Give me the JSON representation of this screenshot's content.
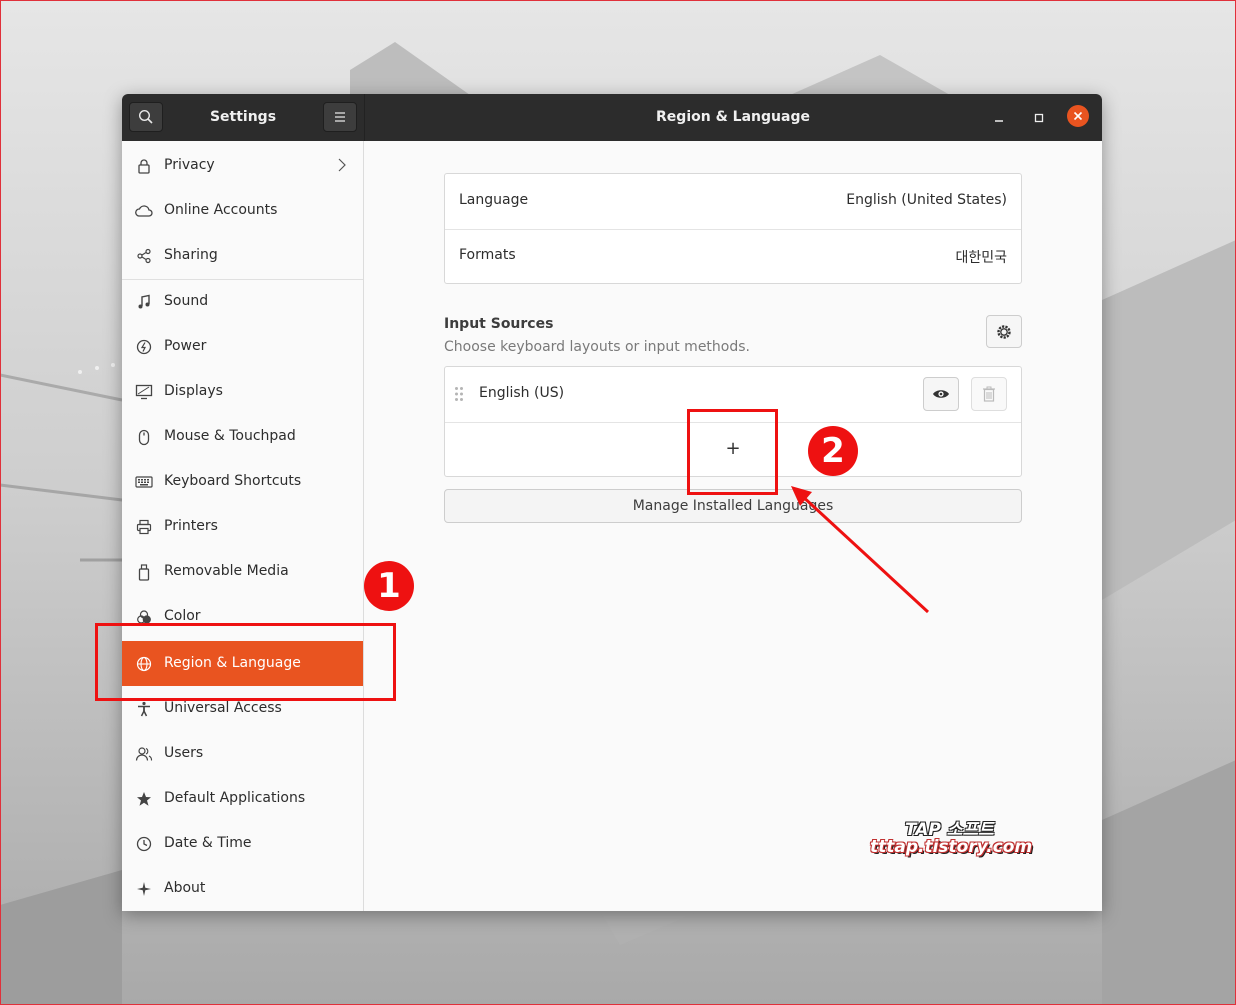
{
  "header": {
    "sidebar_title": "Settings",
    "page_title": "Region & Language"
  },
  "sidebar": {
    "items": [
      {
        "label": "Privacy",
        "icon": "lock-icon",
        "has_chevron": true
      },
      {
        "label": "Online Accounts",
        "icon": "cloud-icon"
      },
      {
        "label": "Sharing",
        "icon": "share-icon"
      },
      {
        "label": "Sound",
        "icon": "music-note-icon"
      },
      {
        "label": "Power",
        "icon": "power-icon"
      },
      {
        "label": "Displays",
        "icon": "display-icon"
      },
      {
        "label": "Mouse & Touchpad",
        "icon": "mouse-icon"
      },
      {
        "label": "Keyboard Shortcuts",
        "icon": "keyboard-icon"
      },
      {
        "label": "Printers",
        "icon": "printer-icon"
      },
      {
        "label": "Removable Media",
        "icon": "usb-drive-icon"
      },
      {
        "label": "Color",
        "icon": "color-icon"
      },
      {
        "label": "Region & Language",
        "icon": "globe-icon",
        "active": true
      },
      {
        "label": "Universal Access",
        "icon": "accessibility-icon"
      },
      {
        "label": "Users",
        "icon": "users-icon"
      },
      {
        "label": "Default Applications",
        "icon": "star-icon"
      },
      {
        "label": "Date & Time",
        "icon": "clock-icon"
      },
      {
        "label": "About",
        "icon": "sparkle-icon"
      }
    ]
  },
  "main": {
    "language_label": "Language",
    "language_value": "English (United States)",
    "formats_label": "Formats",
    "formats_value": "대한민국",
    "input_sources_title": "Input Sources",
    "input_sources_subtitle": "Choose keyboard layouts or input methods.",
    "input_source_item": "English (US)",
    "add_symbol": "+",
    "manage_button": "Manage Installed Languages"
  },
  "annotations": {
    "badge_1": "1",
    "badge_2": "2",
    "highlight_color": "#ee1111"
  },
  "watermark": {
    "line1": "TAP 소프트",
    "line2": "tttap.tistory.com"
  },
  "colors": {
    "accent": "#e95420",
    "headerbar": "#2c2c2c"
  }
}
